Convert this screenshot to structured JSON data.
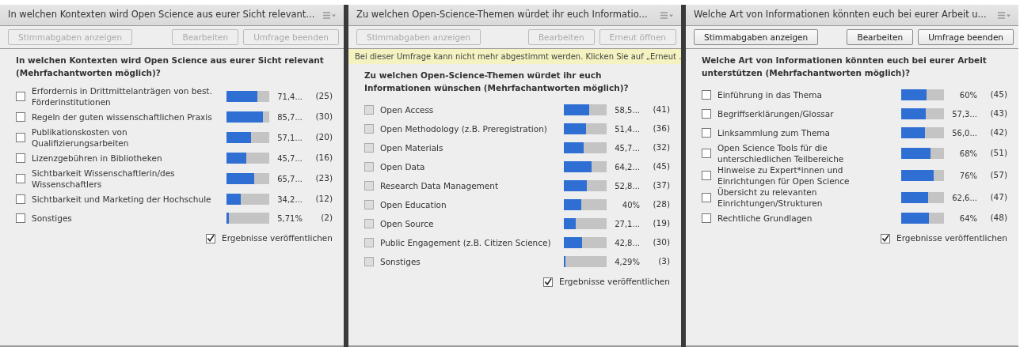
{
  "panels": [
    {
      "title": "In welchen Kontexten wird Open Science aus eurer Sicht relevant...",
      "buttons": [
        {
          "label": "Stimmabgaben anzeigen",
          "disabled": true
        },
        {
          "label": "Bearbeiten",
          "disabled": true
        },
        {
          "label": "Umfrage beenden",
          "disabled": true
        }
      ],
      "question": "In welchen Kontexten wird Open Science aus eurer Sicht relevant (Mehrfachantworten möglich)?",
      "options": [
        {
          "label": "Erfordernis in Drittmittelanträgen von best. Förderinstitutionen",
          "level": 0.714,
          "percent": "71,4...",
          "count": "(25)",
          "checked": false,
          "disabled": false
        },
        {
          "label": "Regeln der guten wissenschaftlichen Praxis",
          "level": 0.857,
          "percent": "85,7...",
          "count": "(30)",
          "checked": false,
          "disabled": false
        },
        {
          "label": "Publikationskosten von Qualifizierungsarbeiten",
          "level": 0.571,
          "percent": "57,1...",
          "count": "(20)",
          "checked": false,
          "disabled": false
        },
        {
          "label": "Lizenzgebühren in Bibliotheken",
          "level": 0.457,
          "percent": "45,7...",
          "count": "(16)",
          "checked": false,
          "disabled": false
        },
        {
          "label": "Sichtbarkeit Wissenschaftlerin/des Wissenschaftlers",
          "level": 0.657,
          "percent": "65,7...",
          "count": "(23)",
          "checked": false,
          "disabled": false
        },
        {
          "label": "Sichtbarkeit und Marketing der Hochschule",
          "level": 0.342,
          "percent": "34,2...",
          "count": "(12)",
          "checked": false,
          "disabled": false
        },
        {
          "label": "Sonstiges",
          "level": 0.0571,
          "percent": "5,71%",
          "count": "(2)",
          "checked": false,
          "disabled": false
        }
      ],
      "publish": {
        "label": "Ergebnisse veröffentlichen",
        "checked": true
      }
    },
    {
      "title": "Zu welchen Open-Science-Themen würdet ihr euch Informatio...",
      "buttons": [
        {
          "label": "Stimmabgaben anzeigen",
          "disabled": true
        },
        {
          "label": "Bearbeiten",
          "disabled": true
        },
        {
          "label": "Erneut öffnen",
          "disabled": true
        }
      ],
      "notice": "Bei dieser Umfrage kann nicht mehr abgestimmt werden. Klicken Sie auf „Erneut .",
      "question": "Zu welchen Open-Science-Themen würdet ihr euch Informationen wünschen (Mehrfachantworten möglich)?",
      "options": [
        {
          "label": "Open Access",
          "level": 0.585,
          "percent": "58,5...",
          "count": "(41)",
          "checked": false,
          "disabled": true
        },
        {
          "label": "Open Methodology (z.B. Preregistration)",
          "level": 0.514,
          "percent": "51,4...",
          "count": "(36)",
          "checked": false,
          "disabled": true
        },
        {
          "label": "Open Materials",
          "level": 0.457,
          "percent": "45,7...",
          "count": "(32)",
          "checked": false,
          "disabled": true
        },
        {
          "label": "Open Data",
          "level": 0.642,
          "percent": "64,2...",
          "count": "(45)",
          "checked": false,
          "disabled": true
        },
        {
          "label": "Research Data Management",
          "level": 0.528,
          "percent": "52,8...",
          "count": "(37)",
          "checked": false,
          "disabled": true
        },
        {
          "label": "Open Education",
          "level": 0.4,
          "percent": "40%",
          "count": "(28)",
          "checked": false,
          "disabled": true
        },
        {
          "label": "Open Source",
          "level": 0.271,
          "percent": "27,1...",
          "count": "(19)",
          "checked": false,
          "disabled": true
        },
        {
          "label": "Public Engagement (z.B. Citizen Science)",
          "level": 0.428,
          "percent": "42,8...",
          "count": "(30)",
          "checked": false,
          "disabled": true
        },
        {
          "label": "Sonstiges",
          "level": 0.0429,
          "percent": "4,29%",
          "count": "(3)",
          "checked": false,
          "disabled": true
        }
      ],
      "publish": {
        "label": "Ergebnisse veröffentlichen",
        "checked": true
      }
    },
    {
      "title": "Welche Art von Informationen könnten euch bei eurer Arbeit u...",
      "buttons": [
        {
          "label": "Stimmabgaben anzeigen",
          "disabled": false
        },
        {
          "label": "Bearbeiten",
          "disabled": false
        },
        {
          "label": "Umfrage beenden",
          "disabled": false
        }
      ],
      "question": "Welche Art von Informationen könnten euch bei eurer Arbeit unterstützen (Mehrfachantworten möglich)?",
      "options": [
        {
          "label": "Einführung in das Thema",
          "level": 0.6,
          "percent": "60%",
          "count": "(45)",
          "checked": false,
          "disabled": false
        },
        {
          "label": "Begriffserklärungen/Glossar",
          "level": 0.573,
          "percent": "57,3...",
          "count": "(43)",
          "checked": false,
          "disabled": false
        },
        {
          "label": "Linksammlung zum Thema",
          "level": 0.56,
          "percent": "56,0...",
          "count": "(42)",
          "checked": false,
          "disabled": false
        },
        {
          "label": "Open Science Tools für die unterschiedlichen Teilbereiche",
          "level": 0.68,
          "percent": "68%",
          "count": "(51)",
          "checked": false,
          "disabled": false
        },
        {
          "label": "Hinweise zu Expert*innen und Einrichtungen für Open Science",
          "level": 0.76,
          "percent": "76%",
          "count": "(57)",
          "checked": false,
          "disabled": false
        },
        {
          "label": "Übersicht zu relevanten Einrichtungen/Strukturen",
          "level": 0.626,
          "percent": "62,6...",
          "count": "(47)",
          "checked": false,
          "disabled": false
        },
        {
          "label": "Rechtliche Grundlagen",
          "level": 0.64,
          "percent": "64%",
          "count": "(48)",
          "checked": false,
          "disabled": false
        }
      ],
      "publish": {
        "label": "Ergebnisse veröffentlichen",
        "checked": true
      }
    }
  ]
}
